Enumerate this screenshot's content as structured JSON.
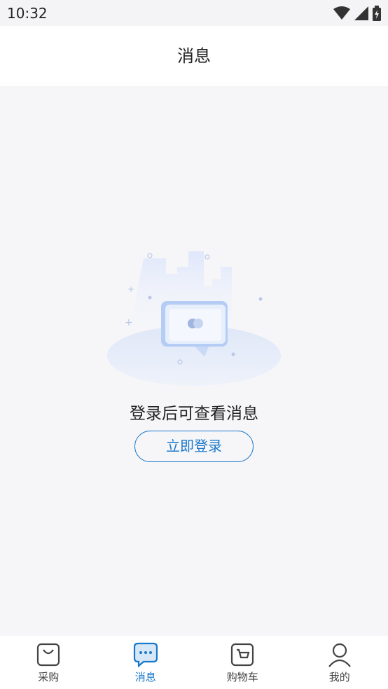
{
  "status_bar": {
    "time": "10:32"
  },
  "header": {
    "title": "消息"
  },
  "empty_state": {
    "message": "登录后可查看消息",
    "login_button": "立即登录"
  },
  "tabbar": {
    "items": [
      {
        "label": "采购",
        "icon": "shopping-bag-icon",
        "active": false
      },
      {
        "label": "消息",
        "icon": "chat-bubble-icon",
        "active": true
      },
      {
        "label": "购物车",
        "icon": "cart-icon",
        "active": false
      },
      {
        "label": "我的",
        "icon": "person-icon",
        "active": false
      }
    ]
  },
  "colors": {
    "accent": "#1a78c9",
    "background": "#f6f6f9"
  }
}
